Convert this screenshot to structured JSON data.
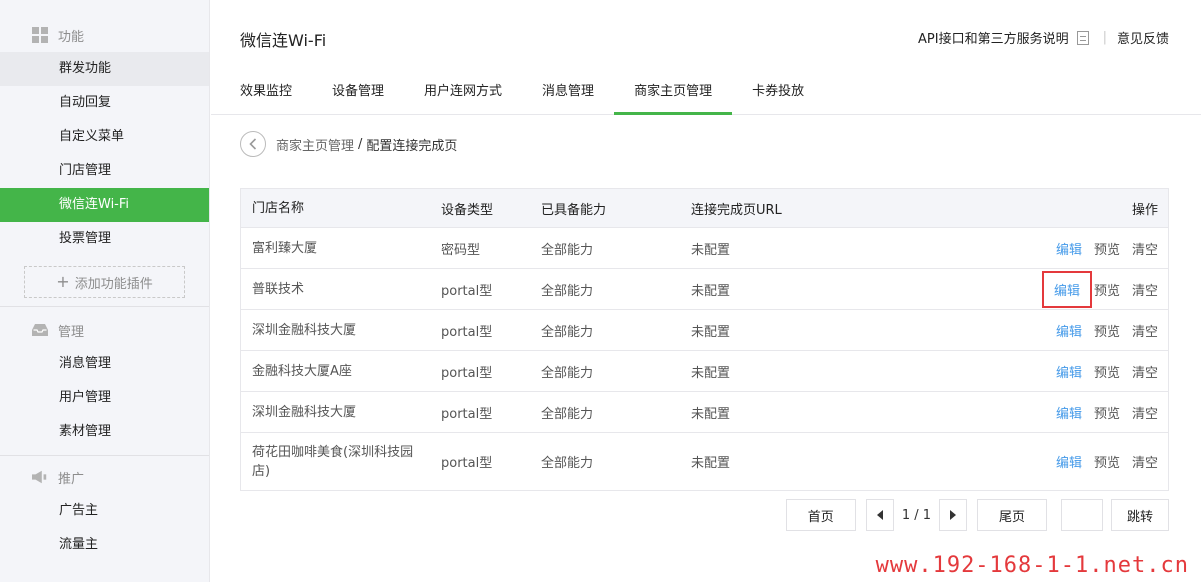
{
  "sidebar": {
    "sections": [
      {
        "title": "功能",
        "icon": "grid-icon",
        "items": [
          "群发功能",
          "自动回复",
          "自定义菜单",
          "门店管理",
          "微信连Wi-Fi",
          "投票管理"
        ]
      },
      {
        "title": "管理",
        "icon": "inbox-icon",
        "items": [
          "消息管理",
          "用户管理",
          "素材管理"
        ]
      },
      {
        "title": "推广",
        "icon": "megaphone-icon",
        "items": [
          "广告主",
          "流量主"
        ]
      }
    ],
    "add_plugin": "添加功能插件",
    "active_item": "微信连Wi-Fi"
  },
  "header": {
    "title": "微信连Wi-Fi",
    "api_link": "API接口和第三方服务说明",
    "feedback_link": "意见反馈"
  },
  "tabs": [
    "效果监控",
    "设备管理",
    "用户连网方式",
    "消息管理",
    "商家主页管理",
    "卡券投放"
  ],
  "active_tab": "商家主页管理",
  "breadcrumb": {
    "parent": "商家主页管理",
    "separator": "/",
    "current": "配置连接完成页"
  },
  "table": {
    "headers": [
      "门店名称",
      "设备类型",
      "已具备能力",
      "连接完成页URL",
      "操作"
    ],
    "rows": [
      {
        "name": "富利臻大厦",
        "type": "密码型",
        "ability": "全部能力",
        "url": "未配置"
      },
      {
        "name": "普联技术",
        "type": "portal型",
        "ability": "全部能力",
        "url": "未配置"
      },
      {
        "name": "深圳金融科技大厦",
        "type": "portal型",
        "ability": "全部能力",
        "url": "未配置"
      },
      {
        "name": "金融科技大厦A座",
        "type": "portal型",
        "ability": "全部能力",
        "url": "未配置"
      },
      {
        "name": "深圳金融科技大厦",
        "type": "portal型",
        "ability": "全部能力",
        "url": "未配置"
      },
      {
        "name": "荷花田咖啡美食(深圳科技园店)",
        "type": "portal型",
        "ability": "全部能力",
        "url": "未配置"
      }
    ],
    "actions": {
      "edit": "编辑",
      "preview": "预览",
      "clear": "清空"
    }
  },
  "pager": {
    "first": "首页",
    "page": "1 / 1",
    "last": "尾页",
    "jump": "跳转"
  },
  "watermark": "www.192-168-1-1.net.cn",
  "colors": {
    "accent": "#44b549",
    "link": "#459ae9",
    "highlight": "#e4393c"
  }
}
